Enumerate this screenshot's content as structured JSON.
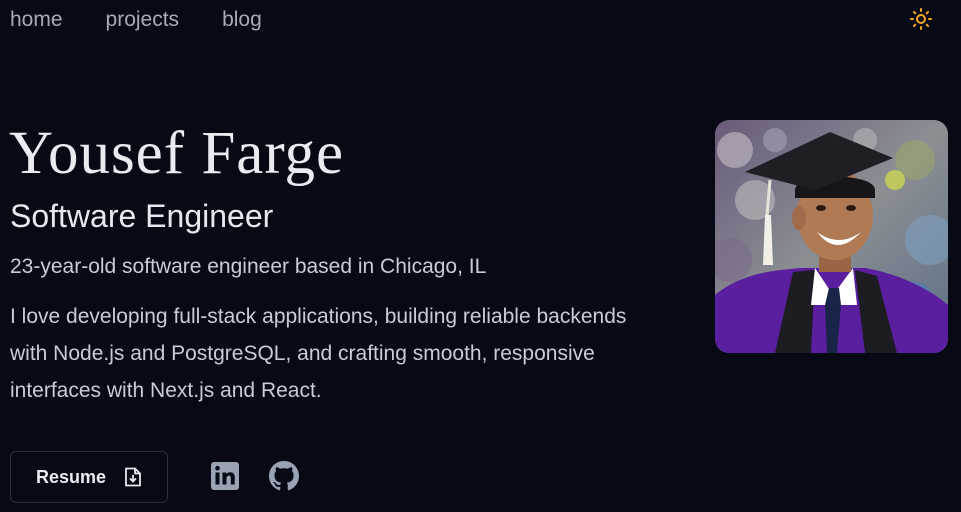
{
  "nav": {
    "items": [
      "home",
      "projects",
      "blog"
    ],
    "theme_icon": "sun-icon"
  },
  "hero": {
    "name": "Yousef Farge",
    "role": "Software Engineer",
    "tagline": "23-year-old software engineer based in Chicago, IL",
    "bio": "I love developing full-stack applications, building reliable backends with Node.js and PostgreSQL, and crafting smooth, responsive interfaces with Next.js and React."
  },
  "actions": {
    "resume_label": "Resume",
    "resume_icon": "file-download-icon",
    "social_icons": [
      "linkedin-icon",
      "github-icon"
    ]
  },
  "colors": {
    "background": "#070914",
    "text": "#e6e8ee",
    "muted": "#a7abb6",
    "accent_sun": "#f5a623",
    "gown_purple": "#5a1f9e"
  }
}
